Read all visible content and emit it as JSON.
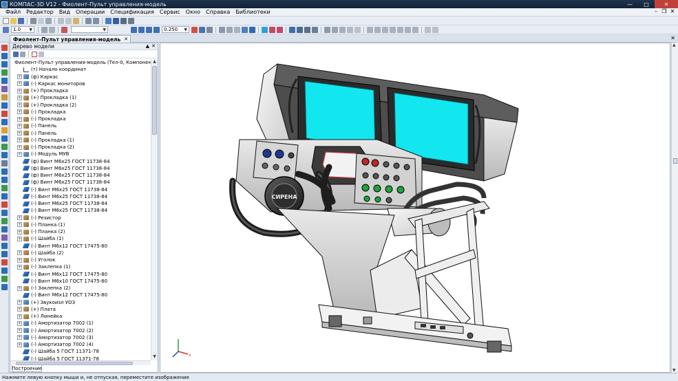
{
  "window": {
    "title": "КОМПАС-3D V12 - Фиолент-Пульт управления-модель"
  },
  "menu": [
    "Файл",
    "Редактор",
    "Вид",
    "Операции",
    "Спецификация",
    "Сервис",
    "Окно",
    "Справка",
    "Библиотеки"
  ],
  "toolbar": {
    "scale_value": "1.0",
    "zoom_value": "0.250"
  },
  "document_tab": {
    "label": "Фиолент-Пульт управления-модель"
  },
  "tree": {
    "title": "Дерево модели",
    "root": "Фиолент-Пульт управления-модель (Тел-0, Компонентов-159)",
    "items": [
      {
        "text": "(т) Начало координат",
        "icon": "origin",
        "exp": ""
      },
      {
        "text": "(ф) Каркас",
        "icon": "asm",
        "exp": "+"
      },
      {
        "text": "(-) Каркас мониторов",
        "icon": "asm",
        "exp": "+"
      },
      {
        "text": "(+) Прокладка",
        "icon": "part",
        "exp": "+"
      },
      {
        "text": "(+) Прокладка (1)",
        "icon": "part",
        "exp": "+"
      },
      {
        "text": "(+) Прокладка (2)",
        "icon": "part",
        "exp": "+"
      },
      {
        "text": "(-) Прокладка",
        "icon": "part",
        "exp": "+"
      },
      {
        "text": "(-) Прокладка",
        "icon": "part",
        "exp": "+"
      },
      {
        "text": "(-) Панель",
        "icon": "part",
        "exp": "+"
      },
      {
        "text": "(-) Панель",
        "icon": "part",
        "exp": "+"
      },
      {
        "text": "(-) Прокладка (1)",
        "icon": "part",
        "exp": "+"
      },
      {
        "text": "(-) Прокладка (2)",
        "icon": "part",
        "exp": "+"
      },
      {
        "text": "(-) Модуль МУВ",
        "icon": "asm",
        "exp": "+"
      },
      {
        "text": "(ф) Винт М6х25 ГОСТ 11738-84",
        "icon": "std",
        "exp": ""
      },
      {
        "text": "(ф) Винт М6х25 ГОСТ 11738-84",
        "icon": "std",
        "exp": ""
      },
      {
        "text": "(ф) Винт М6х25 ГОСТ 11738-84",
        "icon": "std",
        "exp": ""
      },
      {
        "text": "(ф) Винт М6х25 ГОСТ 11738-84",
        "icon": "std",
        "exp": ""
      },
      {
        "text": "(-) Винт М6х25 ГОСТ 11738-84",
        "icon": "std",
        "exp": ""
      },
      {
        "text": "(-) Винт М6х25 ГОСТ 11738-84",
        "icon": "std",
        "exp": ""
      },
      {
        "text": "(-) Винт М6х25 ГОСТ 11738-84",
        "icon": "std",
        "exp": ""
      },
      {
        "text": "(-) Винт М6х25 ГОСТ 11738-84",
        "icon": "std",
        "exp": ""
      },
      {
        "text": "(-) Резистор",
        "icon": "part",
        "exp": "+"
      },
      {
        "text": "(-) Планка (1)",
        "icon": "part",
        "exp": "+"
      },
      {
        "text": "(-) Планка (2)",
        "icon": "part",
        "exp": "+"
      },
      {
        "text": "(-) Шайба (1)",
        "icon": "part",
        "exp": "+"
      },
      {
        "text": "(-) Винт М6х12 ГОСТ 17475-80",
        "icon": "std",
        "exp": ""
      },
      {
        "text": "(-) Шайба (2)",
        "icon": "part",
        "exp": "+"
      },
      {
        "text": "(-) Уголок",
        "icon": "part",
        "exp": "+"
      },
      {
        "text": "(-) Заклепка (1)",
        "icon": "part",
        "exp": "+"
      },
      {
        "text": "(-) Винт М6х12 ГОСТ 17475-80",
        "icon": "std",
        "exp": ""
      },
      {
        "text": "(-) Винт М6х10 ГОСТ 17475-80",
        "icon": "std",
        "exp": ""
      },
      {
        "text": "(-) Заклепка (2)",
        "icon": "part",
        "exp": "+"
      },
      {
        "text": "(-) Винт М6х12 ГОСТ 17475-80",
        "icon": "std",
        "exp": ""
      },
      {
        "text": "(+) Звукоизл УОЗ",
        "icon": "asm",
        "exp": "+"
      },
      {
        "text": "(+) Плата",
        "icon": "part",
        "exp": "+"
      },
      {
        "text": "(+) Линейка",
        "icon": "part",
        "exp": "+"
      },
      {
        "text": "(-) Амортизатор 7002 (1)",
        "icon": "asm",
        "exp": "+"
      },
      {
        "text": "(-) Амортизатор 7002 (2)",
        "icon": "asm",
        "exp": "+"
      },
      {
        "text": "(-) Амортизатор 7002 (3)",
        "icon": "asm",
        "exp": "+"
      },
      {
        "text": "(-) Амортизатор 7002 (4)",
        "icon": "asm",
        "exp": "+"
      },
      {
        "text": "(-) Шайба 5 ГОСТ 11371-78",
        "icon": "std",
        "exp": ""
      },
      {
        "text": "(-) Шайба 5 ГОСТ 11371-78",
        "icon": "std",
        "exp": ""
      }
    ],
    "bottom_tab": "Построение"
  },
  "model": {
    "hub_label": "СИРЕНА"
  },
  "status": {
    "hint": "Нажмите левую кнопку мыши и, не отпуская, переместите изображение"
  }
}
